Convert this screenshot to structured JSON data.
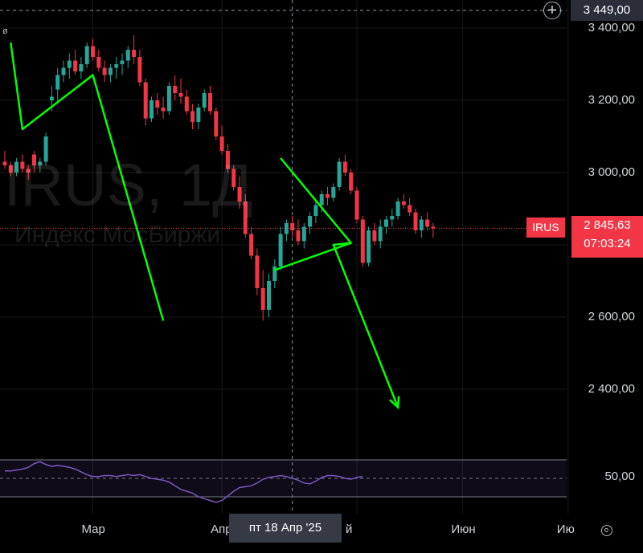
{
  "chart_data": {
    "type": "candlestick",
    "symbol": "IRUS",
    "interval": "1Д",
    "watermark_symbol": "IRUS, 1Д",
    "watermark_name": "Индекс МосБиржи",
    "top_glyph": "ø",
    "y_ticks": [
      "3 400,00",
      "3 200,00",
      "3 000,00",
      "2 600,00",
      "2 400,00"
    ],
    "y_tick_values": [
      3400,
      3200,
      3000,
      2600,
      2400
    ],
    "x_ticks": [
      "Мар",
      "Апр",
      "й",
      "Июн",
      "Ию"
    ],
    "x_tick_index": [
      15,
      37,
      60,
      78,
      96
    ],
    "crosshair_price": "3 449,00",
    "crosshair_date": "пт 18 Апр '25",
    "crosshair_index": 49,
    "current_price": "2 845,63",
    "current_price_value": 2845.63,
    "countdown": "07:03:24",
    "rsi_label": "50,00",
    "rsi_band": [
      30,
      70
    ],
    "colors": {
      "up": "#26a69a",
      "down": "#f23645",
      "drawing": "#00ff00",
      "rsi": "#7e57c2"
    },
    "candles": [
      [
        3030,
        3060,
        3010,
        3020
      ],
      [
        3020,
        3030,
        2990,
        3000
      ],
      [
        3000,
        3040,
        2990,
        3030
      ],
      [
        3030,
        3050,
        3000,
        3010
      ],
      [
        3010,
        3020,
        2980,
        3000
      ],
      [
        3050,
        3060,
        3000,
        3020
      ],
      [
        3020,
        3040,
        3000,
        3030
      ],
      [
        3030,
        3110,
        3020,
        3100
      ],
      [
        3200,
        3240,
        3170,
        3210
      ],
      [
        3230,
        3290,
        3190,
        3270
      ],
      [
        3270,
        3310,
        3250,
        3290
      ],
      [
        3290,
        3330,
        3260,
        3310
      ],
      [
        3310,
        3340,
        3270,
        3280
      ],
      [
        3280,
        3320,
        3260,
        3300
      ],
      [
        3300,
        3360,
        3290,
        3350
      ],
      [
        3350,
        3370,
        3310,
        3320
      ],
      [
        3320,
        3340,
        3280,
        3290
      ],
      [
        3290,
        3310,
        3250,
        3270
      ],
      [
        3270,
        3300,
        3250,
        3290
      ],
      [
        3290,
        3320,
        3260,
        3300
      ],
      [
        3300,
        3330,
        3270,
        3310
      ],
      [
        3310,
        3350,
        3290,
        3340
      ],
      [
        3340,
        3380,
        3300,
        3320
      ],
      [
        3320,
        3340,
        3240,
        3250
      ],
      [
        3250,
        3260,
        3130,
        3150
      ],
      [
        3150,
        3210,
        3140,
        3200
      ],
      [
        3200,
        3220,
        3160,
        3180
      ],
      [
        3180,
        3210,
        3150,
        3170
      ],
      [
        3170,
        3250,
        3160,
        3240
      ],
      [
        3240,
        3270,
        3200,
        3220
      ],
      [
        3220,
        3260,
        3190,
        3210
      ],
      [
        3210,
        3230,
        3160,
        3170
      ],
      [
        3170,
        3190,
        3120,
        3140
      ],
      [
        3140,
        3190,
        3120,
        3180
      ],
      [
        3180,
        3230,
        3170,
        3220
      ],
      [
        3220,
        3240,
        3160,
        3170
      ],
      [
        3170,
        3180,
        3090,
        3100
      ],
      [
        3100,
        3130,
        3050,
        3060
      ],
      [
        3060,
        3080,
        3000,
        3010
      ],
      [
        3010,
        3020,
        2950,
        2960
      ],
      [
        2960,
        2990,
        2900,
        2920
      ],
      [
        2920,
        2940,
        2820,
        2830
      ],
      [
        2830,
        2850,
        2760,
        2770
      ],
      [
        2770,
        2790,
        2660,
        2680
      ],
      [
        2680,
        2730,
        2590,
        2620
      ],
      [
        2620,
        2720,
        2600,
        2700
      ],
      [
        2700,
        2760,
        2680,
        2740
      ],
      [
        2740,
        2850,
        2730,
        2830
      ],
      [
        2830,
        2870,
        2810,
        2860
      ],
      [
        2860,
        2880,
        2820,
        2840
      ],
      [
        2840,
        2870,
        2800,
        2810
      ],
      [
        2810,
        2860,
        2790,
        2850
      ],
      [
        2850,
        2890,
        2830,
        2880
      ],
      [
        2880,
        2920,
        2860,
        2910
      ],
      [
        2910,
        2950,
        2890,
        2940
      ],
      [
        2940,
        2960,
        2910,
        2930
      ],
      [
        2930,
        2970,
        2920,
        2960
      ],
      [
        2960,
        3040,
        2950,
        3030
      ],
      [
        3030,
        3050,
        2990,
        3000
      ],
      [
        3000,
        3010,
        2940,
        2950
      ],
      [
        2950,
        2960,
        2860,
        2870
      ],
      [
        2870,
        2880,
        2740,
        2750
      ],
      [
        2750,
        2850,
        2740,
        2840
      ],
      [
        2840,
        2860,
        2800,
        2810
      ],
      [
        2810,
        2870,
        2790,
        2850
      ],
      [
        2850,
        2880,
        2830,
        2870
      ],
      [
        2870,
        2900,
        2850,
        2880
      ],
      [
        2880,
        2930,
        2870,
        2920
      ],
      [
        2920,
        2940,
        2900,
        2910
      ],
      [
        2910,
        2930,
        2880,
        2890
      ],
      [
        2890,
        2900,
        2830,
        2840
      ],
      [
        2840,
        2880,
        2820,
        2870
      ],
      [
        2870,
        2890,
        2840,
        2850
      ],
      [
        2850,
        2860,
        2820,
        2846
      ]
    ],
    "rsi": [
      58,
      58,
      59,
      60,
      62,
      66,
      68,
      65,
      63,
      64,
      63,
      62,
      60,
      57,
      54,
      52,
      52,
      53,
      53,
      52,
      53,
      54,
      53,
      54,
      52,
      50,
      49,
      48,
      46,
      42,
      38,
      36,
      34,
      30,
      28,
      26,
      24,
      26,
      31,
      36,
      40,
      41,
      42,
      45,
      49,
      51,
      52,
      53,
      52,
      50,
      48,
      45,
      44,
      47,
      51,
      53,
      53,
      52,
      50,
      49,
      51,
      52
    ],
    "drawings": [
      {
        "points": [
          [
            1,
            3360
          ],
          [
            3,
            3120
          ],
          [
            15,
            3270
          ],
          [
            27,
            2590
          ]
        ]
      },
      {
        "points": [
          [
            47,
            3040
          ],
          [
            59,
            2805
          ],
          [
            46,
            2730
          ],
          [
            59,
            2805
          ],
          [
            56,
            2800
          ],
          [
            67,
            2350
          ]
        ],
        "arrow": true
      }
    ]
  }
}
